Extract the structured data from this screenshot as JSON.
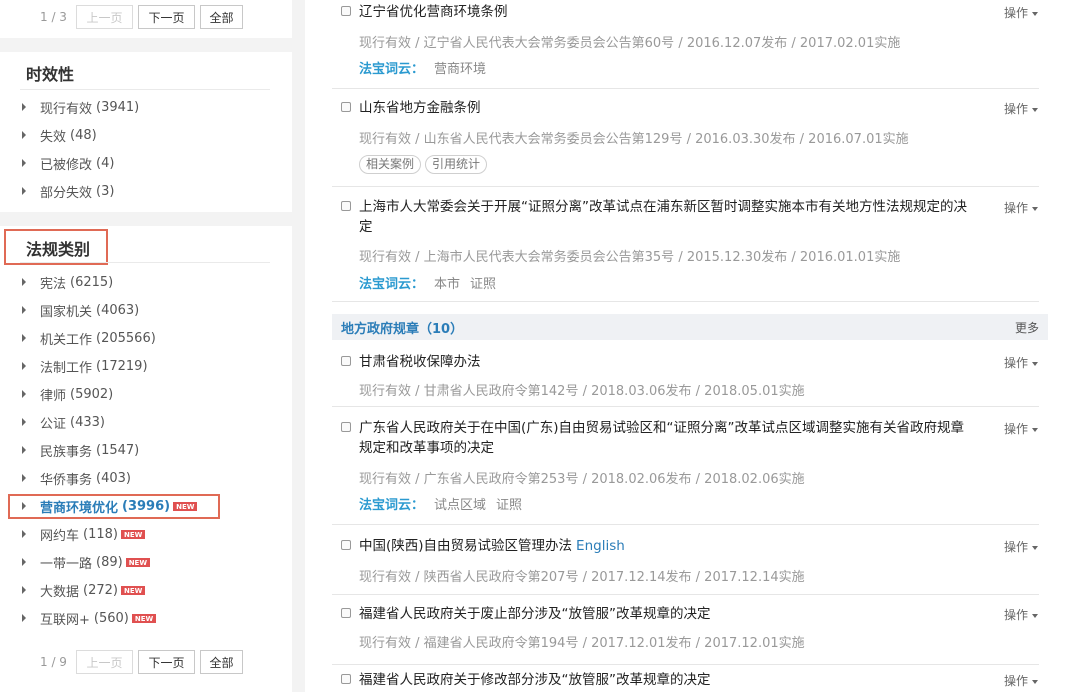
{
  "sidebar": {
    "top_pager": {
      "count": "1 / 3",
      "prev": "上一页",
      "next": "下一页",
      "all": "全部"
    },
    "validity": {
      "title": "时效性",
      "items": [
        {
          "name": "现行有效",
          "count": "(3941)"
        },
        {
          "name": "失效",
          "count": "(48)"
        },
        {
          "name": "已被修改",
          "count": "(4)"
        },
        {
          "name": "部分失效",
          "count": "(3)"
        }
      ]
    },
    "category": {
      "title": "法规类别",
      "items": [
        {
          "name": "宪法",
          "count": "(6215)"
        },
        {
          "name": "国家机关",
          "count": "(4063)"
        },
        {
          "name": "机关工作",
          "count": "(205566)"
        },
        {
          "name": "法制工作",
          "count": "(17219)"
        },
        {
          "name": "律师",
          "count": "(5902)"
        },
        {
          "name": "公证",
          "count": "(433)"
        },
        {
          "name": "民族事务",
          "count": "(1547)"
        },
        {
          "name": "华侨事务",
          "count": "(403)"
        },
        {
          "name": "营商环境优化",
          "count": "(3996)",
          "badge": "NEW"
        },
        {
          "name": "网约车",
          "count": "(118)",
          "badge": "NEW"
        },
        {
          "name": "一带一路",
          "count": "(89)",
          "badge": "NEW"
        },
        {
          "name": "大数据",
          "count": "(272)",
          "badge": "NEW"
        },
        {
          "name": "互联网+",
          "count": "(560)",
          "badge": "NEW"
        }
      ],
      "pager": {
        "count": "1 / 9",
        "prev": "上一页",
        "next": "下一页",
        "all": "全部"
      }
    }
  },
  "main": {
    "ops_label": "操作",
    "tag_label": "法宝词云：",
    "results_top": [
      {
        "title": "辽宁省优化营商环境条例",
        "meta": "现行有效 / 辽宁省人民代表大会常务委员会公告第60号 / 2016.12.07发布 / 2017.02.01实施",
        "tags": [
          "营商环境"
        ]
      },
      {
        "title": "山东省地方金融条例",
        "meta": "现行有效 / 山东省人民代表大会常务委员会公告第129号 / 2016.03.30发布 / 2016.07.01实施",
        "chips": [
          "相关案例",
          "引用统计"
        ]
      },
      {
        "title": "上海市人大常委会关于开展“证照分离”改革试点在浦东新区暂时调整实施本市有关地方性法规规定的决定",
        "meta": "现行有效 / 上海市人民代表大会常务委员会公告第35号 / 2015.12.30发布 / 2016.01.01实施",
        "tags": [
          "本市",
          "证照"
        ]
      }
    ],
    "section": {
      "title": "地方政府规章（10）",
      "more": "更多"
    },
    "results_section": [
      {
        "title": "甘肃省税收保障办法",
        "meta": "现行有效 / 甘肃省人民政府令第142号 / 2018.03.06发布 / 2018.05.01实施"
      },
      {
        "title": "广东省人民政府关于在中国(广东)自由贸易试验区和“证照分离”改革试点区域调整实施有关省政府规章规定和改革事项的决定",
        "meta": "现行有效 / 广东省人民政府令第253号 / 2018.02.06发布 / 2018.02.06实施",
        "tags": [
          "试点区域",
          "证照"
        ]
      },
      {
        "title": "中国(陕西)自由贸易试验区管理办法",
        "title_extra": "English",
        "meta": "现行有效 / 陕西省人民政府令第207号 / 2017.12.14发布 / 2017.12.14实施"
      },
      {
        "title": "福建省人民政府关于废止部分涉及“放管服”改革规章的决定",
        "meta": "现行有效 / 福建省人民政府令第194号 / 2017.12.01发布 / 2017.12.01实施"
      },
      {
        "title": "福建省人民政府关于修改部分涉及“放管服”改革规章的决定"
      }
    ]
  }
}
